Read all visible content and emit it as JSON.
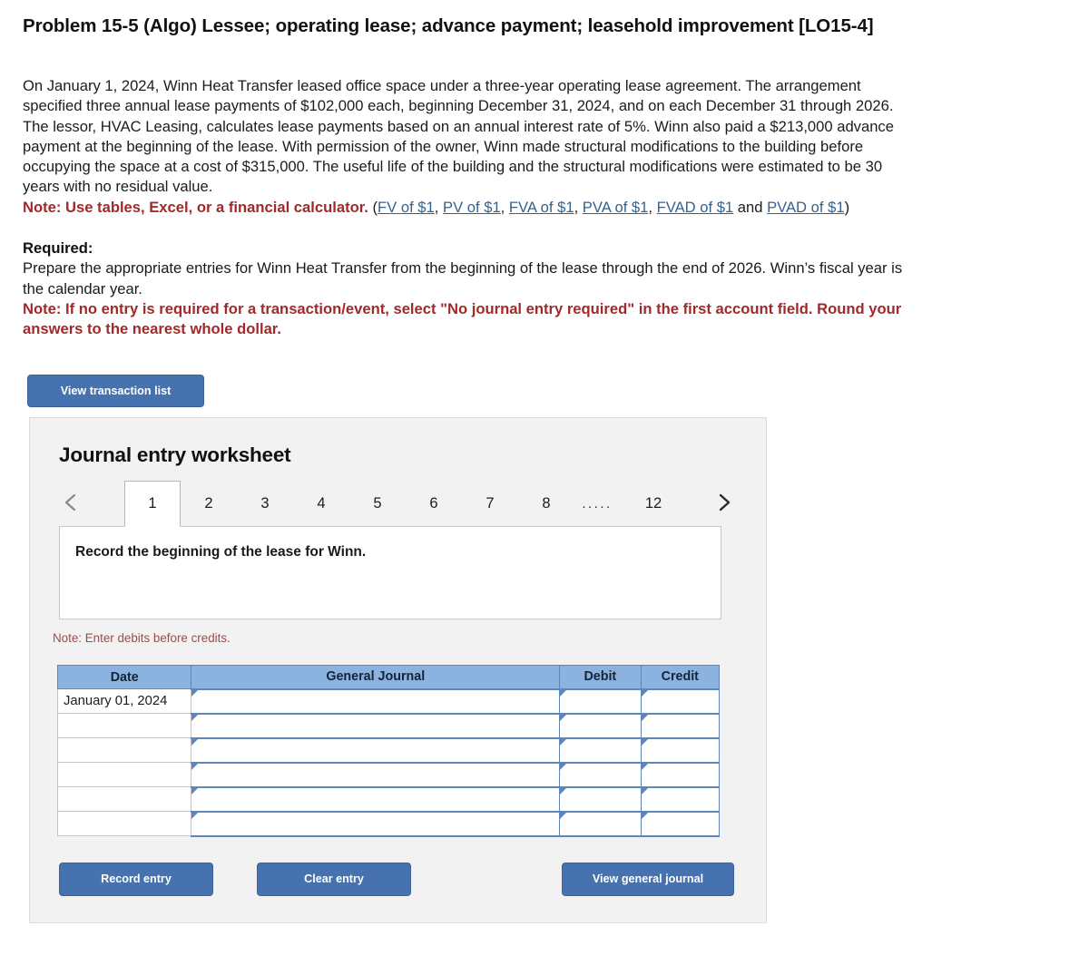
{
  "problem": {
    "title": "Problem 15-5 (Algo) Lessee; operating lease; advance payment; leasehold improvement [LO15-4]",
    "narrative_line1": "On January 1, 2024, Winn Heat Transfer leased office space under a three-year operating lease agreement. The arrangement",
    "narrative_line2": "specified three annual lease payments of $102,000 each, beginning December 31, 2024, and on each December 31 through 2026.",
    "narrative_line3": "The lessor, HVAC Leasing, calculates lease payments based on an annual interest rate of 5%. Winn also paid a $213,000 advance",
    "narrative_line4": "payment at the beginning of the lease. With permission of the owner, Winn made structural modifications to the building before",
    "narrative_line5": "occupying the space at a cost of $315,000. The useful life of the building and the structural modifications were estimated to be 30",
    "narrative_line6": "years with no residual value.",
    "note_tables": "Note: Use tables, Excel, or a financial calculator.",
    "links_open_paren": "(",
    "links": [
      "FV of $1",
      "PV of $1",
      "FVA of $1",
      "PVA of $1",
      "FVAD of $1",
      "PVAD of $1"
    ],
    "links_and": " and ",
    "links_close_paren": ")",
    "links_comma": ", ",
    "required_label": "Required:",
    "required_line1": "Prepare the appropriate entries for Winn Heat Transfer from the beginning of the lease through the end of 2026. Winn’s fiscal year is",
    "required_line2": "the calendar year.",
    "required_note_line1": "Note: If no entry is required for a transaction/event, select \"No journal entry required\" in the first account field. Round your",
    "required_note_line2": "answers to the nearest whole dollar."
  },
  "toolbar": {
    "view_transaction_list_label": "View transaction list"
  },
  "worksheet": {
    "title": "Journal entry worksheet",
    "tabs": [
      {
        "label": "1",
        "active": true
      },
      {
        "label": "2",
        "active": false
      },
      {
        "label": "3",
        "active": false
      },
      {
        "label": "4",
        "active": false
      },
      {
        "label": "5",
        "active": false
      },
      {
        "label": "6",
        "active": false
      },
      {
        "label": "7",
        "active": false
      },
      {
        "label": "8",
        "active": false
      },
      {
        "label": ".....",
        "active": false
      },
      {
        "label": "12",
        "active": false
      }
    ],
    "prev_icon": "chevron-left-icon",
    "next_icon": "chevron-right-icon",
    "description": "Record the beginning of the lease for Winn.",
    "note_debits": "Note: Enter debits before credits.",
    "table": {
      "headers": [
        "Date",
        "General Journal",
        "Debit",
        "Credit"
      ],
      "rows": [
        {
          "date": "January 01, 2024",
          "general_journal": "",
          "debit": "",
          "credit": ""
        },
        {
          "date": "",
          "general_journal": "",
          "debit": "",
          "credit": ""
        },
        {
          "date": "",
          "general_journal": "",
          "debit": "",
          "credit": ""
        },
        {
          "date": "",
          "general_journal": "",
          "debit": "",
          "credit": ""
        },
        {
          "date": "",
          "general_journal": "",
          "debit": "",
          "credit": ""
        },
        {
          "date": "",
          "general_journal": "",
          "debit": "",
          "credit": ""
        }
      ]
    },
    "buttons": {
      "record_entry": "Record entry",
      "clear_entry": "Clear entry",
      "view_general_journal": "View general journal"
    }
  },
  "colors": {
    "button_blue": "#4672b0",
    "table_header_blue": "#8cb3e0",
    "note_red": "#a32929",
    "link_blue": "#33628f",
    "panel_gray": "#f2f2f2"
  }
}
